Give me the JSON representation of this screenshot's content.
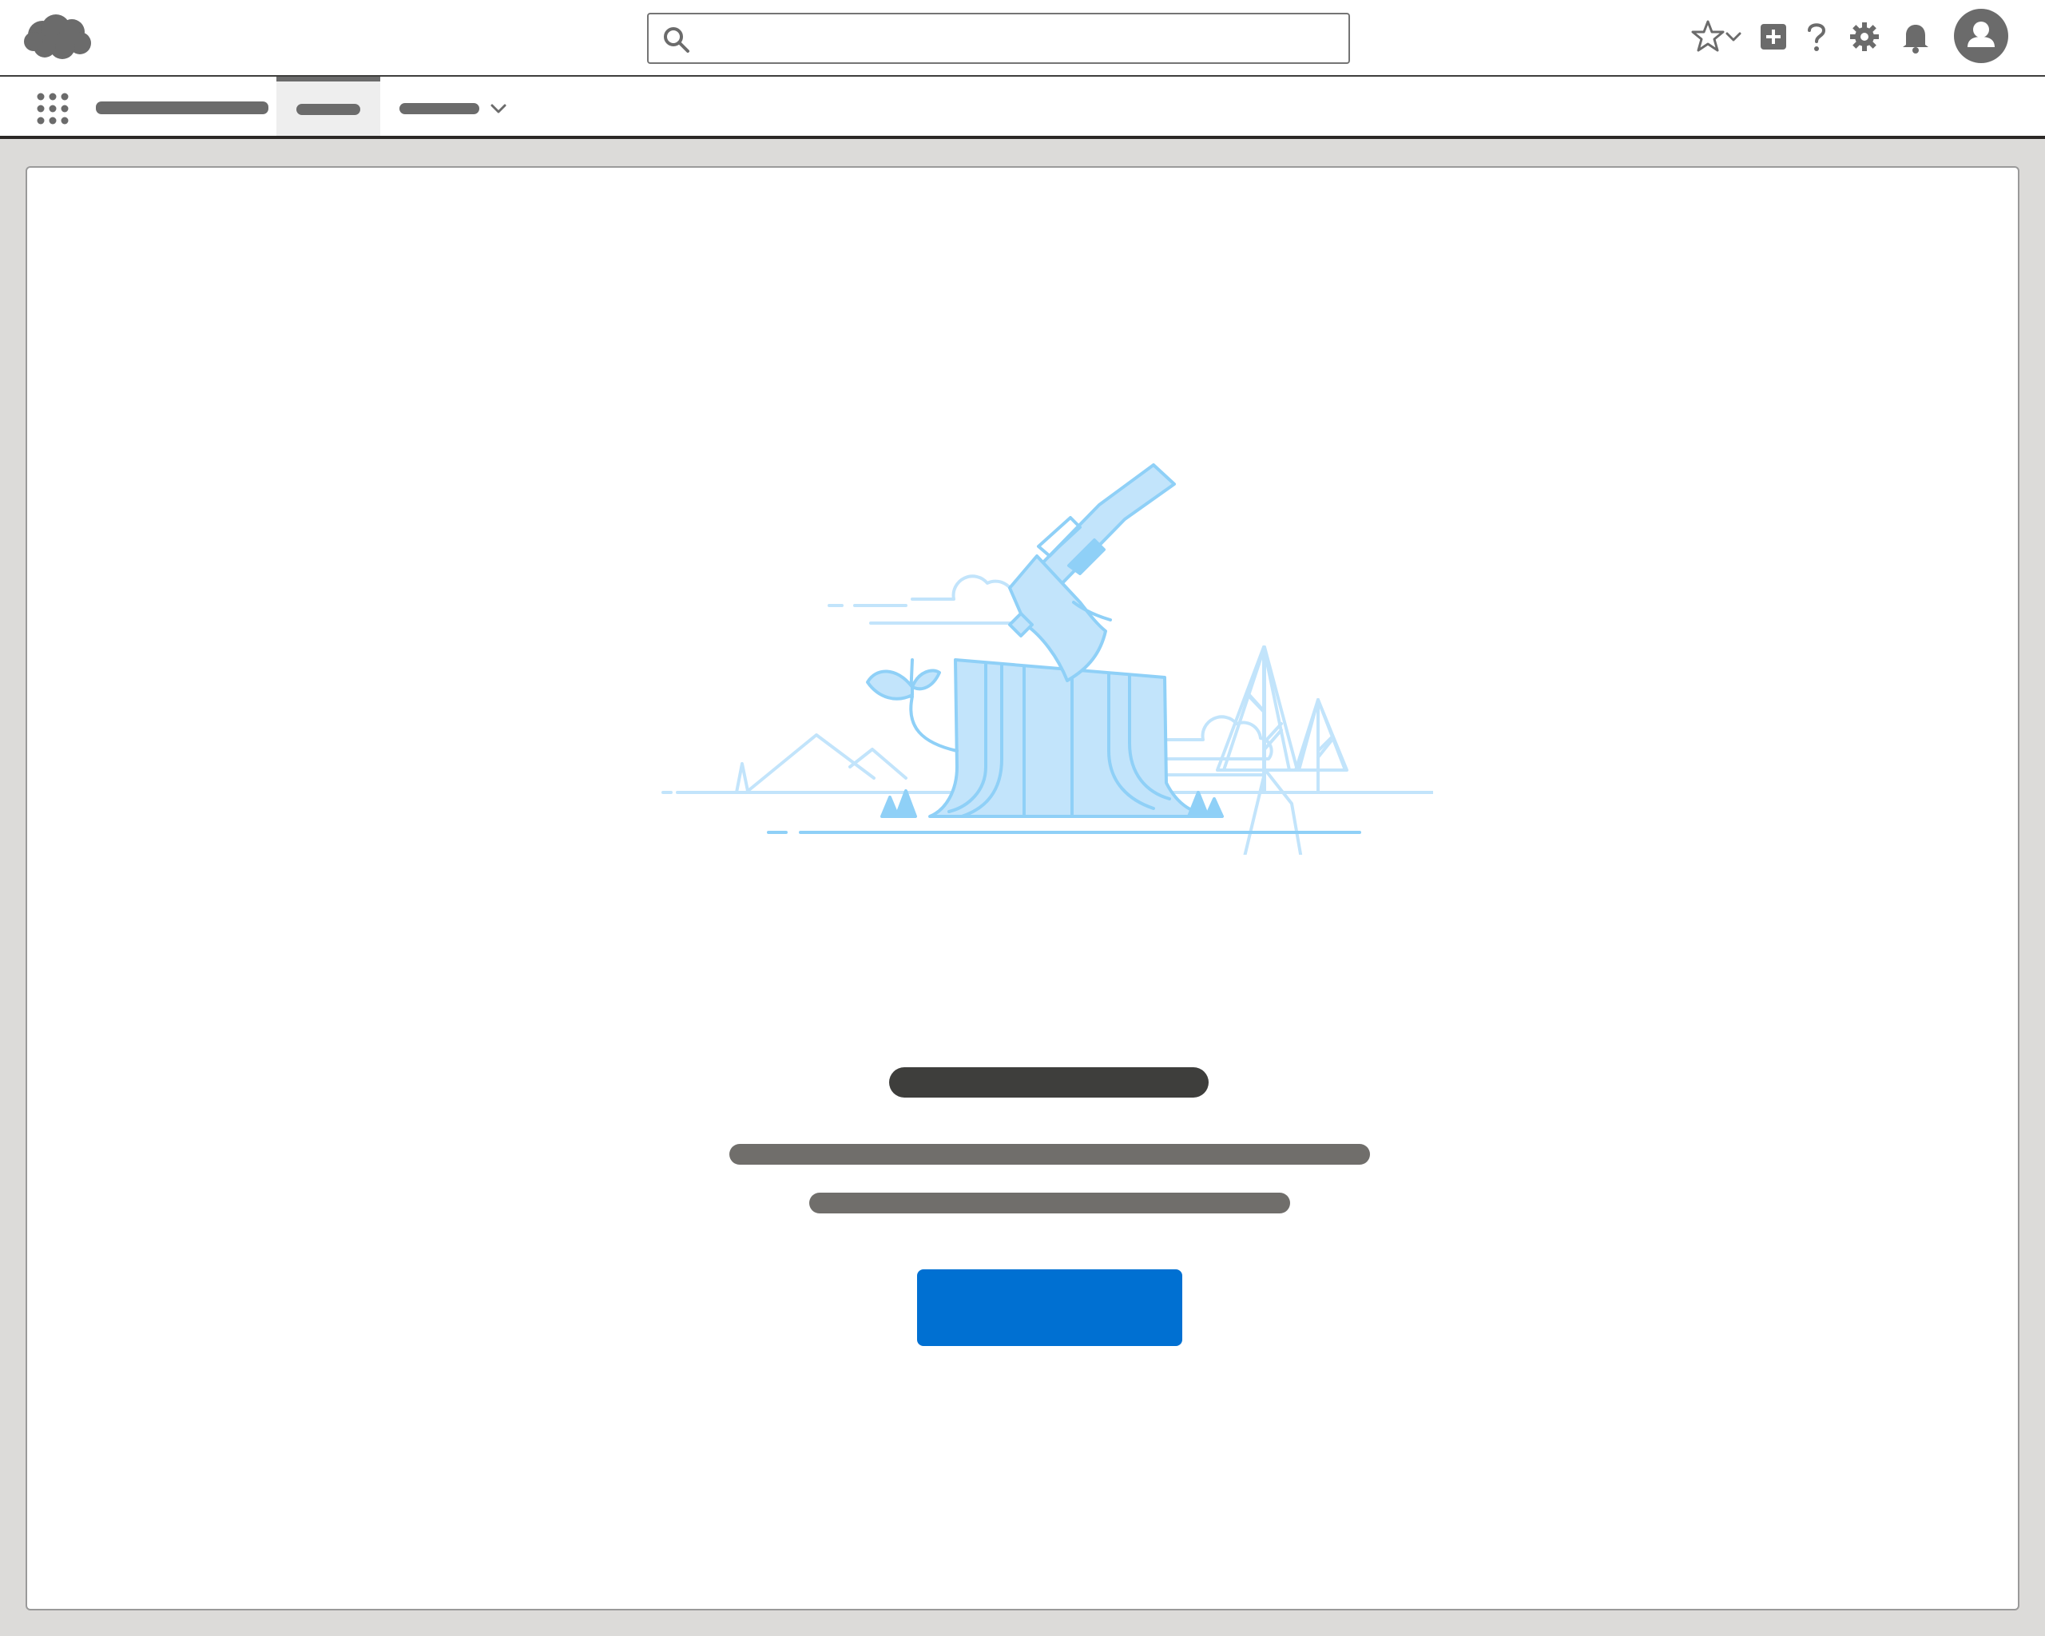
{
  "header": {
    "search": {
      "placeholder": "",
      "value": ""
    },
    "icons": [
      "cloud-logo-icon",
      "search-icon",
      "favorites-star-icon",
      "chevron-down-icon",
      "global-actions-plus-icon",
      "help-question-icon",
      "setup-gear-icon",
      "notifications-bell-icon",
      "user-avatar-icon"
    ]
  },
  "nav": {
    "app_name": "",
    "tabs": [
      {
        "label": ""
      },
      {
        "label": ""
      }
    ]
  },
  "empty_state": {
    "title": "",
    "message_line1": "",
    "message_line2": "",
    "button_label": ""
  },
  "colors": {
    "brand_blue": "#0070d2",
    "illustration_light": "#c2e4fb",
    "illustration_stroke": "#8fd0f7",
    "text_dark": "#3e3e3c",
    "text_muted": "#706e6b"
  }
}
